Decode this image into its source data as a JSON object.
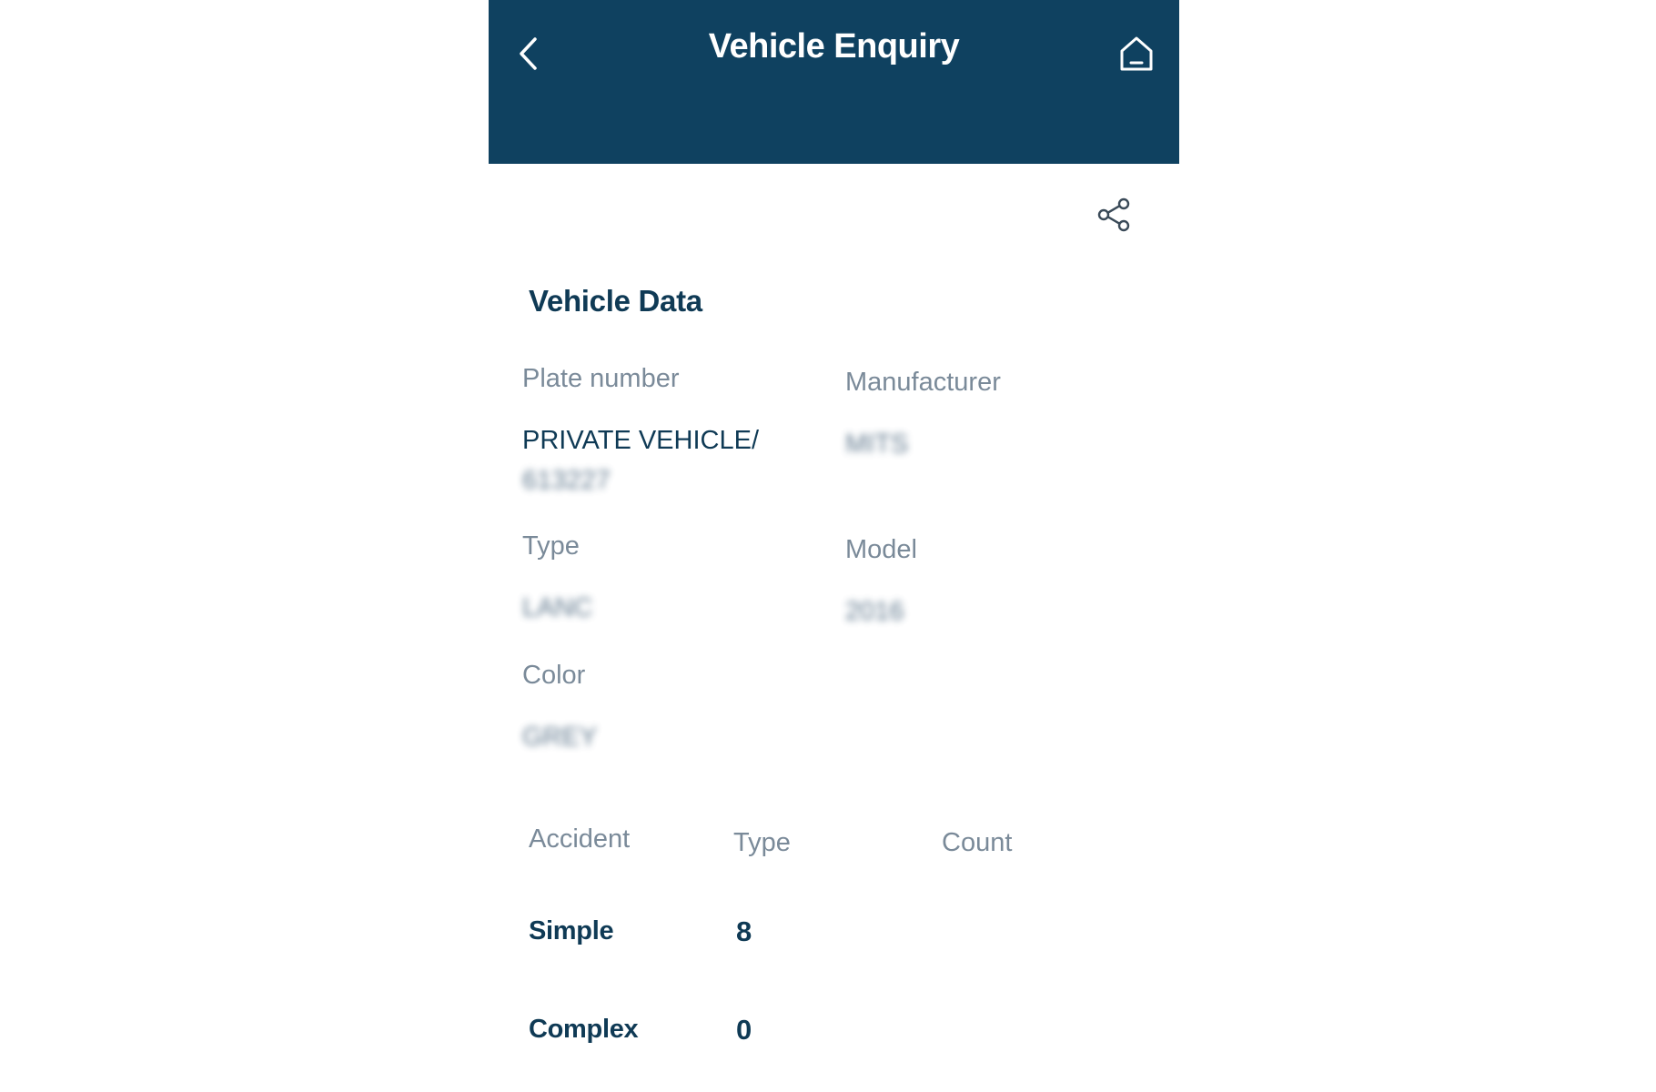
{
  "header": {
    "title": "Vehicle Enquiry",
    "back_icon": "chevron-left-icon",
    "home_icon": "home-icon",
    "background_color": "#0f4160"
  },
  "actions": {
    "share_icon": "share-icon"
  },
  "vehicle_data": {
    "section_title": "Vehicle Data",
    "fields": {
      "plate_number": {
        "label": "Plate number",
        "value_line1": "PRIVATE VEHICLE/",
        "value_line2": "613227"
      },
      "manufacturer": {
        "label": "Manufacturer",
        "value": "MITS"
      },
      "type": {
        "label": "Type",
        "value": "LANC"
      },
      "model": {
        "label": "Model",
        "value": "2016"
      },
      "color": {
        "label": "Color",
        "value": "GREY"
      }
    }
  },
  "accidents": {
    "columns": [
      "Accident",
      "Type",
      "Count"
    ],
    "rows": [
      {
        "type": "Simple",
        "count": "8"
      },
      {
        "type": "Complex",
        "count": "0"
      }
    ]
  }
}
